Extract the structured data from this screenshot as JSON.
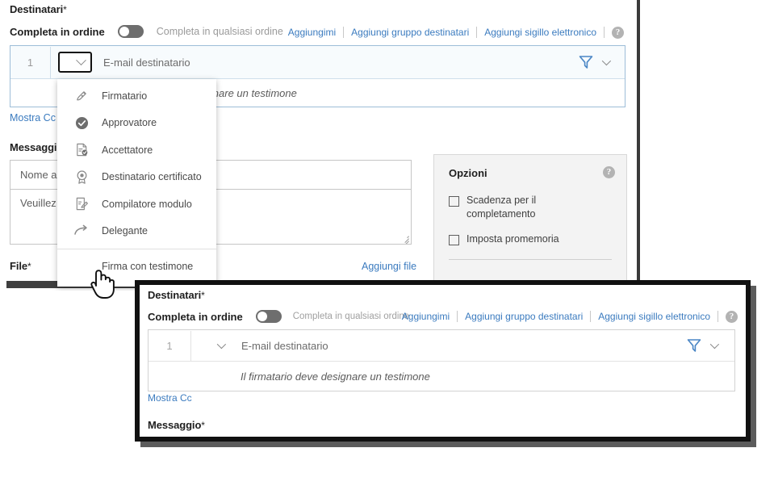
{
  "main": {
    "destinatari_title": "Destinatari",
    "required_star": "*",
    "order_label": "Completa in ordine",
    "order_alt_label": "Completa in qualsiasi ordine",
    "actions": [
      {
        "label": "Aggiungimi"
      },
      {
        "label": "Aggiungi gruppo destinatari"
      },
      {
        "label": "Aggiungi sigillo elettronico"
      }
    ],
    "help_glyph": "?",
    "recipient": {
      "index": "1",
      "email_placeholder": "E-mail destinatario",
      "witness_note": "Il firmatario deve designare un testimone",
      "filter_icon": "filter-funnel-icon"
    },
    "mostra_cc": "Mostra Cc",
    "messaggio_title": "Messaggio",
    "message_name_value": "Nome accordo",
    "message_body_value": "Veuillez re",
    "options": {
      "title": "Opzioni",
      "items": [
        {
          "label": "Scadenza per il completamento",
          "checked": false
        },
        {
          "label": "Imposta promemoria",
          "checked": false
        }
      ]
    },
    "file_title": "File",
    "file_add_link": "Aggiungi file"
  },
  "role_menu": {
    "items": [
      {
        "label": "Firmatario",
        "icon": "pen-signature-icon"
      },
      {
        "label": "Approvatore",
        "icon": "check-circle-icon"
      },
      {
        "label": "Accettatore",
        "icon": "document-check-icon"
      },
      {
        "label": "Destinatario certificato",
        "icon": "certificate-seal-icon"
      },
      {
        "label": "Compilatore modulo",
        "icon": "form-fill-icon"
      },
      {
        "label": "Delegante",
        "icon": "arrow-forward-icon"
      }
    ],
    "footer_item": {
      "label": "Firma con testimone",
      "icon": "none"
    }
  },
  "inset": {
    "destinatari_title": "Destinatari",
    "required_star": "*",
    "order_label": "Completa in ordine",
    "order_alt_label": "Completa in qualsiasi ordine",
    "actions": [
      {
        "label": "Aggiungimi"
      },
      {
        "label": "Aggiungi gruppo destinatari"
      },
      {
        "label": "Aggiungi sigillo elettronico"
      }
    ],
    "help_glyph": "?",
    "recipient": {
      "index": "1",
      "email_placeholder": "E-mail destinatario",
      "witness_note": "Il firmatario deve designare un testimone"
    },
    "mostra_cc": "Mostra Cc",
    "messaggio_title": "Messaggio"
  },
  "colors": {
    "link_blue": "#3b7bbf",
    "filter_blue": "#4a86c5",
    "recipient_border": "#9dbdd8",
    "recipient_bg": "#f7fbfd",
    "toggle_track": "#6e6e6e",
    "options_bg": "#f3f3f3",
    "inset_border": "#111111",
    "text_dark": "#1f1f1f",
    "text_muted": "#9a9a9a"
  },
  "cursor": {
    "type": "pointing-hand-cursor"
  }
}
